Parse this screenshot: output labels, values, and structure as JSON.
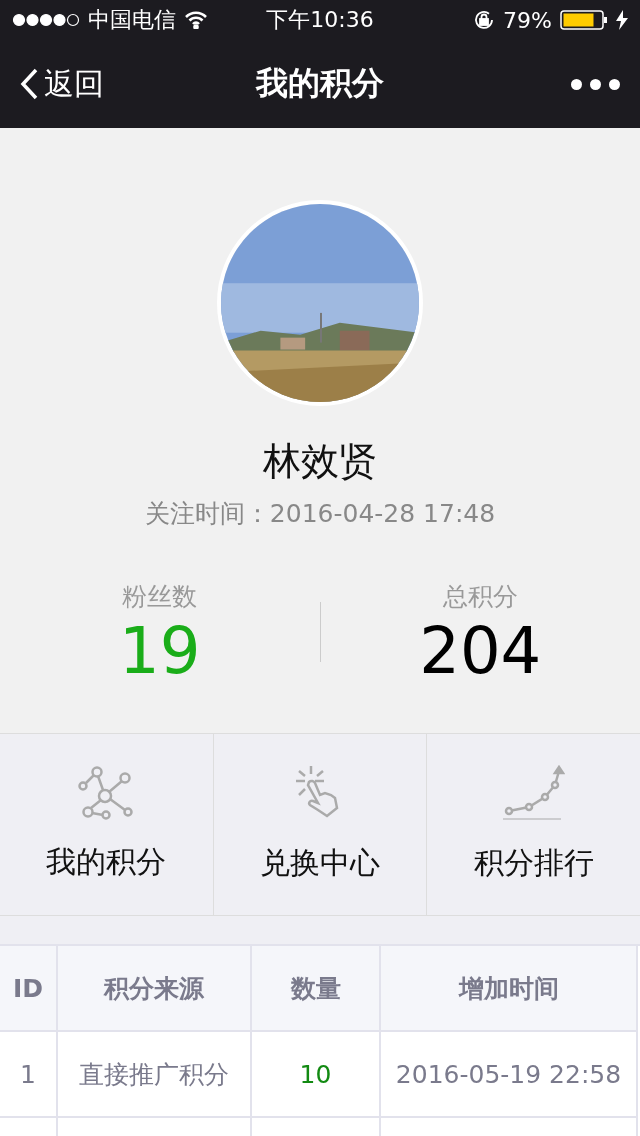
{
  "status_bar": {
    "carrier": "中国电信",
    "time": "下午10:36",
    "battery": "79%"
  },
  "nav": {
    "back": "返回",
    "title": "我的积分"
  },
  "profile": {
    "name": "林效贤",
    "follow_label": "关注时间：",
    "follow_time": "2016-04-28 17:48"
  },
  "stats": [
    {
      "label": "粉丝数",
      "value": "19",
      "color": "#1aad19"
    },
    {
      "label": "总积分",
      "value": "204",
      "color": "#000000"
    }
  ],
  "menu": [
    {
      "label": "我的积分"
    },
    {
      "label": "兑换中心"
    },
    {
      "label": "积分排行"
    }
  ],
  "table": {
    "columns": [
      "ID",
      "积分来源",
      "数量",
      "增加时间"
    ],
    "rows": [
      {
        "id": "1",
        "source": "直接推广积分",
        "amount": "10",
        "time": "2016-05-19 22:58"
      }
    ]
  }
}
